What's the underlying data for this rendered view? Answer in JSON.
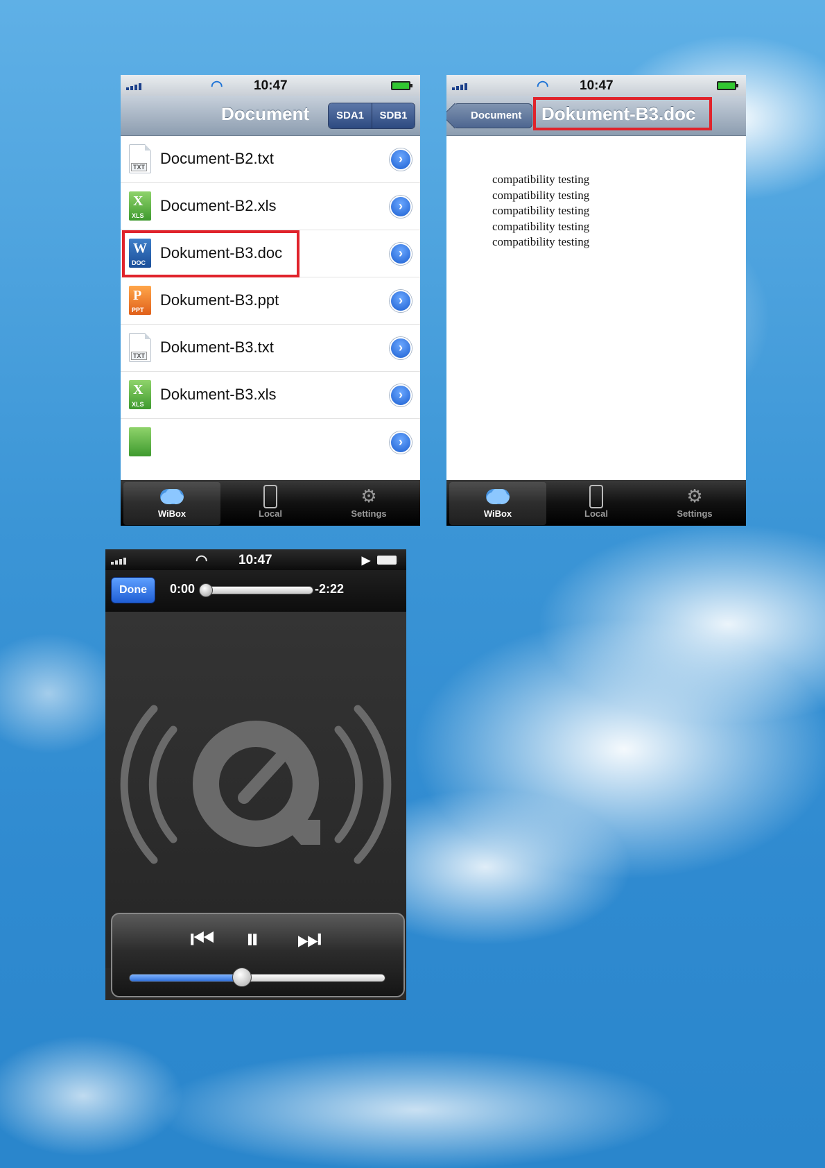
{
  "status_bar": {
    "time": "10:47"
  },
  "browser_screen": {
    "title": "Document",
    "segments": [
      "SDA1",
      "SDB1"
    ],
    "files": [
      {
        "name": "Document-B2.txt",
        "type": "TXT",
        "letter": ""
      },
      {
        "name": "Document-B2.xls",
        "type": "XLS",
        "letter": "X"
      },
      {
        "name": "Dokument-B3.doc",
        "type": "DOC",
        "letter": "W",
        "highlighted": true
      },
      {
        "name": "Dokument-B3.ppt",
        "type": "PPT",
        "letter": "P"
      },
      {
        "name": "Dokument-B3.txt",
        "type": "TXT",
        "letter": ""
      },
      {
        "name": "Dokument-B3.xls",
        "type": "XLS",
        "letter": "X"
      }
    ],
    "media_filters": [
      "inbox-icon",
      "photos-icon",
      "music-icon",
      "video-icon",
      "document-icon"
    ],
    "active_filter": "document-icon",
    "refresh_icon": "refresh-icon"
  },
  "viewer_screen": {
    "back_label": "Document",
    "title": "Dokument-B3.doc",
    "content_lines": [
      "compatibility testing",
      "compatibility testing",
      "compatibility testing",
      "compatibility testing",
      "compatibility testing"
    ]
  },
  "tabs": [
    {
      "label": "WiBox",
      "icon": "cloud-icon",
      "selected": true
    },
    {
      "label": "Local",
      "icon": "phone-icon",
      "selected": false
    },
    {
      "label": "Settings",
      "icon": "gear-icon",
      "selected": false
    }
  ],
  "player_screen": {
    "done_label": "Done",
    "elapsed": "0:00",
    "remaining": "-2:22",
    "playback_progress": 0.0,
    "volume_level": 0.44,
    "controls": {
      "previous": "⏮",
      "pause": "⏸",
      "next": "⏭"
    }
  },
  "colors": {
    "highlight": "#e0232b",
    "nav_blue": "#2d4a80",
    "accent_blue": "#1f5ed4"
  }
}
